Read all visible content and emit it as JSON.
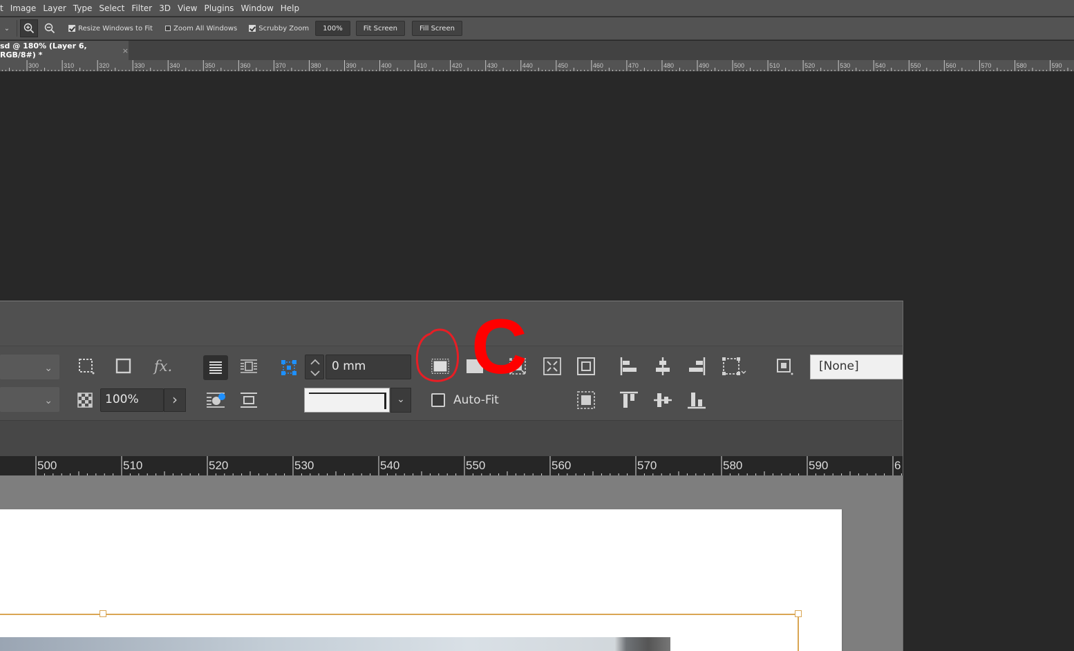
{
  "menu": {
    "items": [
      "t",
      "Image",
      "Layer",
      "Type",
      "Select",
      "Filter",
      "3D",
      "View",
      "Plugins",
      "Window",
      "Help"
    ]
  },
  "options_bar": {
    "zoom_in_icon": "zoom-in-icon",
    "zoom_out_icon": "zoom-out-icon",
    "resize_windows_label": "Resize Windows to Fit",
    "resize_windows_checked": true,
    "zoom_all_label": "Zoom All Windows",
    "zoom_all_checked": false,
    "scrubby_label": "Scrubby Zoom",
    "scrubby_checked": true,
    "zoom_value": "100%",
    "fit_screen": "Fit Screen",
    "fill_screen": "Fill Screen"
  },
  "document_tab": {
    "title": "sd @ 180% (Layer 6, RGB/8#) *",
    "close": "×"
  },
  "top_ruler": {
    "labels": [
      "0",
      "300",
      "310",
      "320",
      "330",
      "340",
      "350",
      "360",
      "370",
      "380",
      "390",
      "400",
      "410",
      "420",
      "430",
      "440",
      "450",
      "460",
      "470",
      "480",
      "490",
      "500",
      "510",
      "520",
      "530",
      "540",
      "550",
      "560",
      "570",
      "580",
      "590"
    ]
  },
  "screenshot_panel": {
    "scale_value": "100%",
    "stroke_weight": "0 mm",
    "auto_fit_label": "Auto-Fit",
    "auto_fit_checked": false,
    "fx_label": "fx.",
    "style_value": "[None]",
    "annotation_letter": "C",
    "annotation_color": "#ff0000",
    "ruler_labels": [
      "500",
      "510",
      "520",
      "530",
      "540",
      "550",
      "560",
      "570",
      "580",
      "590",
      "6"
    ]
  },
  "colors": {
    "accent_blue": "#1e90ff",
    "frame_orange": "#d9a552"
  }
}
